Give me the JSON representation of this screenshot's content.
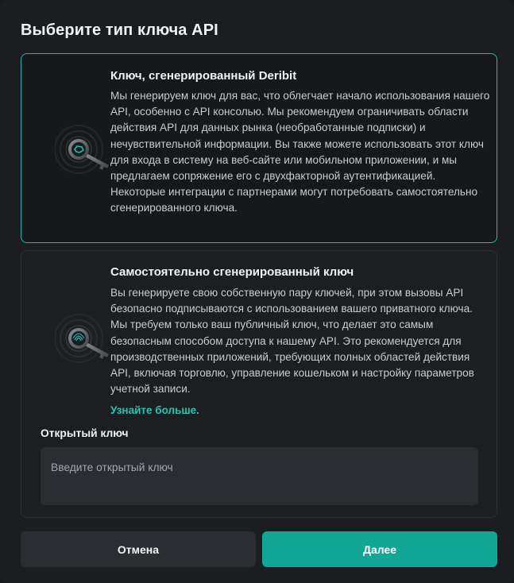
{
  "dialog": {
    "title": "Выберите тип ключа API"
  },
  "options": [
    {
      "heading": "Ключ, сгенерированный Deribit",
      "description": "Мы генерируем ключ для вас, что облегчает начало использования нашего API, особенно с API консолью. Мы рекомендуем ограничивать области действия API для данных рынка (необработанные подписки) и нечувствительной информации. Вы также можете использовать этот ключ для входа в систему на веб-сайте или мобильном приложении, и мы предлагаем сопряжение его с двухфакторной аутентификацией. Некоторые интеграции с партнерами могут потребовать самостоятельно сгенерированного ключа.",
      "icon": "key-icon",
      "selected": true
    },
    {
      "heading": "Самостоятельно сгенерированный ключ",
      "description": "Вы генерируете свою собственную пару ключей, при этом вызовы API безопасно подписываются с использованием вашего приватного ключа. Мы требуем только ваш публичный ключ, что делает это самым безопасным способом доступа к нашему API. Это рекомендуется для производственных приложений, требующих полных областей действия API, включая торговлю, управление кошельком и настройку параметров учетной записи.",
      "learn_more": "Узнайте больше.",
      "icon": "fingerprint-key-icon",
      "selected": false,
      "public_key": {
        "label": "Открытый ключ",
        "placeholder": "Введите открытый ключ",
        "value": ""
      }
    }
  ],
  "footer": {
    "cancel_label": "Отмена",
    "next_label": "Далее"
  },
  "colors": {
    "accent": "#22c6b4",
    "selected_border": "#25b9ac",
    "primary_button": "#12a696",
    "background": "#1b1d20"
  }
}
